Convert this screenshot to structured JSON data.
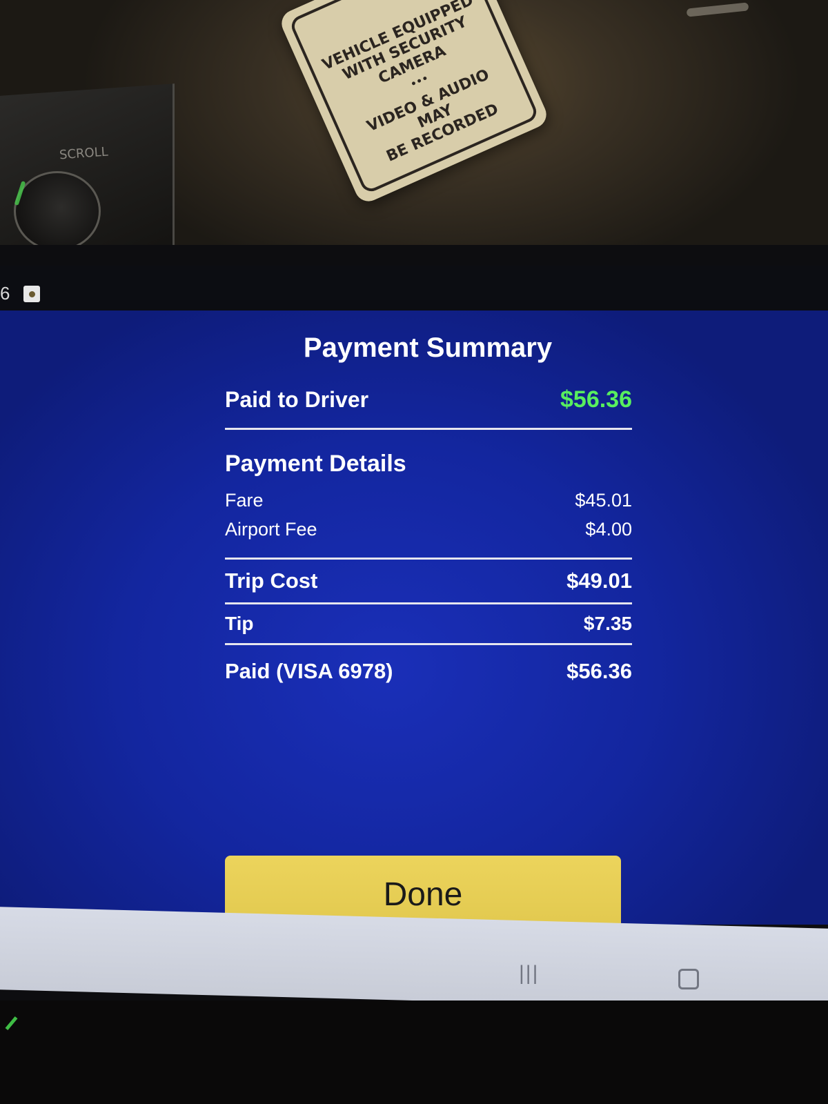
{
  "environment": {
    "scroll_label": "SCROLL",
    "sticker_lines": [
      "VEHICLE EQUIPPED",
      "WITH SECURITY",
      "CAMERA"
    ],
    "sticker_separator": "•••",
    "sticker_lines_2": [
      "VIDEO & AUDIO",
      "MAY",
      "BE RECORDED"
    ]
  },
  "status_bar": {
    "time_fragment": "6"
  },
  "payment_summary": {
    "title": "Payment Summary",
    "paid_to_driver_label": "Paid to Driver",
    "paid_to_driver_amount": "$56.36",
    "details_title": "Payment Details",
    "fare_label": "Fare",
    "fare_amount": "$45.01",
    "airport_fee_label": "Airport Fee",
    "airport_fee_amount": "$4.00",
    "trip_cost_label": "Trip Cost",
    "trip_cost_amount": "$49.01",
    "tip_label": "Tip",
    "tip_amount": "$7.35",
    "paid_label": "Paid (VISA 6978)",
    "paid_amount": "$56.36",
    "done_label": "Done"
  },
  "nav_bar": {
    "recents_glyph": "|||"
  },
  "colors": {
    "screen_blue": "#1a2fb8",
    "accent_green": "#58ef5e",
    "button_yellow": "#ecd45c"
  },
  "icons": [
    "status-app-icon",
    "recents-icon",
    "home-icon"
  ]
}
